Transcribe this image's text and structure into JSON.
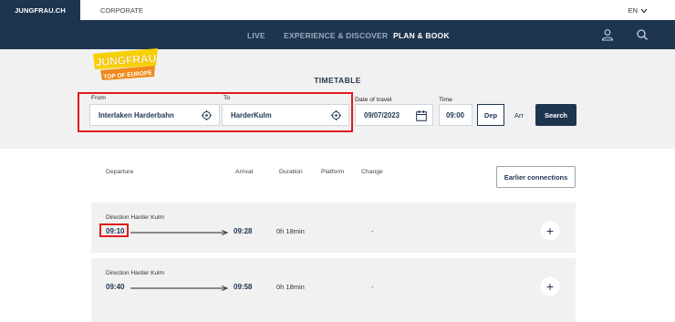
{
  "topbar": {
    "site": "JUNGFRAU.CH",
    "corporate": "CORPORATE",
    "language": "EN"
  },
  "nav": {
    "items": [
      "LIVE",
      "EXPERIENCE & DISCOVER",
      "PLAN & BOOK"
    ],
    "active": "PLAN & BOOK"
  },
  "logo": {
    "line1": "JUNGFRAU",
    "line2": "TOP OF EUROPE"
  },
  "timetable": {
    "title": "TIMETABLE",
    "from_label": "From",
    "from_value": "Interlaken Harderbahn",
    "to_label": "To",
    "to_value": "HarderKulm",
    "date_label": "Date of travel",
    "date_value": "09/07/2023",
    "time_label": "Time",
    "time_value": "09:00",
    "dep_label": "Dep",
    "arr_label": "Arr",
    "search_label": "Search"
  },
  "results": {
    "headers": {
      "departure": "Departure",
      "arrival": "Arrival",
      "duration": "Duration",
      "platform": "Platform",
      "change": "Change"
    },
    "earlier_label": "Earlier connections",
    "connections": [
      {
        "direction": "Direction Harder Kulm",
        "departure": "09:10",
        "arrival": "09:28",
        "duration": "0h 18min",
        "change": "-"
      },
      {
        "direction": "Direction Harder Kulm",
        "departure": "09:40",
        "arrival": "09:58",
        "duration": "0h 18min",
        "change": "-"
      }
    ]
  },
  "colors": {
    "navy": "#1e3550",
    "highlight": "#e01b1b",
    "logo_yellow": "#f6d100",
    "logo_orange": "#f08a1c"
  },
  "icons": [
    "chevron-down-icon",
    "user-icon",
    "search-icon",
    "crosshair-icon",
    "calendar-icon",
    "arrow-right-icon",
    "plus-icon"
  ]
}
